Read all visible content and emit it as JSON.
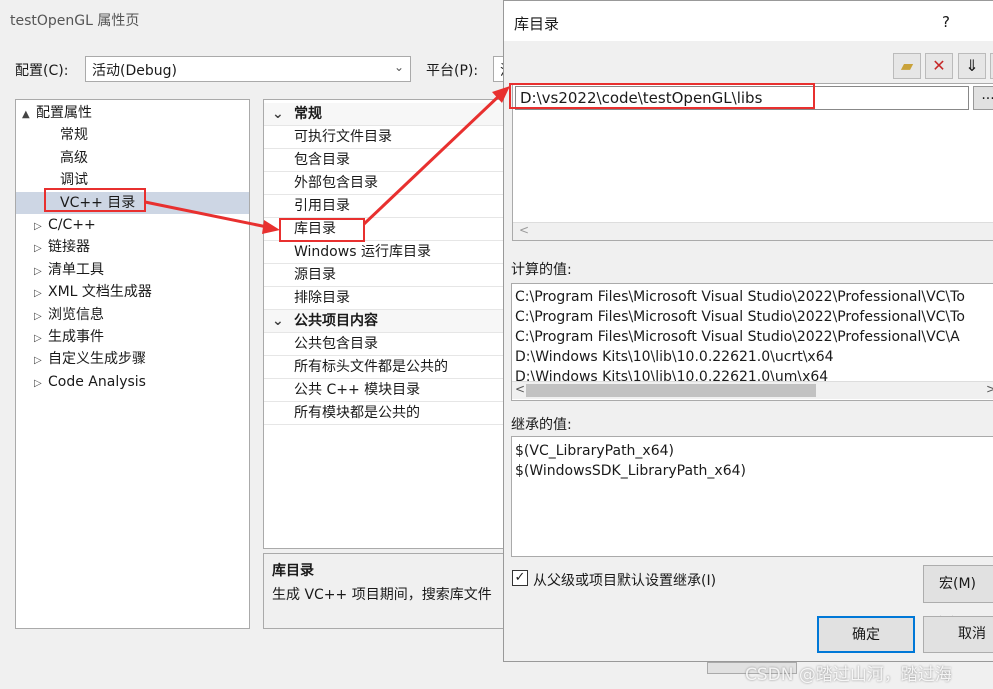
{
  "window": {
    "title": "testOpenGL 属性页",
    "config_label": "配置(C):",
    "config_value": "活动(Debug)",
    "platform_label": "平台(P):",
    "platform_value": "活"
  },
  "tree": {
    "items": [
      {
        "label": "配置属性",
        "expander": "▲",
        "indent": 0
      },
      {
        "label": "常规",
        "expander": "",
        "indent": 2
      },
      {
        "label": "高级",
        "expander": "",
        "indent": 2
      },
      {
        "label": "调试",
        "expander": "",
        "indent": 2
      },
      {
        "label": "VC++ 目录",
        "expander": "",
        "indent": 2,
        "selected": true
      },
      {
        "label": "C/C++",
        "expander": "▷",
        "indent": 1
      },
      {
        "label": "链接器",
        "expander": "▷",
        "indent": 1
      },
      {
        "label": "清单工具",
        "expander": "▷",
        "indent": 1
      },
      {
        "label": "XML 文档生成器",
        "expander": "▷",
        "indent": 1
      },
      {
        "label": "浏览信息",
        "expander": "▷",
        "indent": 1
      },
      {
        "label": "生成事件",
        "expander": "▷",
        "indent": 1
      },
      {
        "label": "自定义生成步骤",
        "expander": "▷",
        "indent": 1
      },
      {
        "label": "Code Analysis",
        "expander": "▷",
        "indent": 1
      }
    ]
  },
  "grid": {
    "rows": [
      {
        "label": "常规",
        "cat": true
      },
      {
        "label": "可执行文件目录"
      },
      {
        "label": "包含目录"
      },
      {
        "label": "外部包含目录"
      },
      {
        "label": "引用目录"
      },
      {
        "label": "库目录",
        "selected": true
      },
      {
        "label": "Windows 运行库目录"
      },
      {
        "label": "源目录"
      },
      {
        "label": "排除目录"
      },
      {
        "label": "公共项目内容",
        "cat": true
      },
      {
        "label": "公共包含目录"
      },
      {
        "label": "所有标头文件都是公共的"
      },
      {
        "label": "公共 C++ 模块目录"
      },
      {
        "label": "所有模块都是公共的"
      }
    ]
  },
  "description": {
    "title": "库目录",
    "text": "生成 VC++ 项目期间，搜索库文件"
  },
  "dialog": {
    "title": "库目录",
    "help": "?",
    "toolbar": {
      "new_folder": "new-folder-icon",
      "delete": "delete-icon",
      "move_down": "arrow-down-icon"
    },
    "entry_value": "D:\\vs2022\\code\\testOpenGL\\libs",
    "browse": "...",
    "evaluated_label": "计算的值:",
    "evaluated": [
      "C:\\Program Files\\Microsoft Visual Studio\\2022\\Professional\\VC\\To",
      "C:\\Program Files\\Microsoft Visual Studio\\2022\\Professional\\VC\\To",
      "C:\\Program Files\\Microsoft Visual Studio\\2022\\Professional\\VC\\A",
      "D:\\Windows Kits\\10\\lib\\10.0.22621.0\\ucrt\\x64",
      "D:\\Windows Kits\\10\\lib\\10.0.22621.0\\um\\x64"
    ],
    "inherited_label": "继承的值:",
    "inherited": [
      "$(VC_LibraryPath_x64)",
      "$(WindowsSDK_LibraryPath_x64)"
    ],
    "inherit_checkbox": "从父级或项目默认设置继承(I)",
    "inherit_checked": true,
    "macros": "宏(M) >>",
    "ok": "确定",
    "cancel": "取消"
  },
  "watermark": "CSDN @踏过山河，踏过海",
  "colors": {
    "highlight": "#e8302f",
    "selection": "#cce4f7"
  }
}
